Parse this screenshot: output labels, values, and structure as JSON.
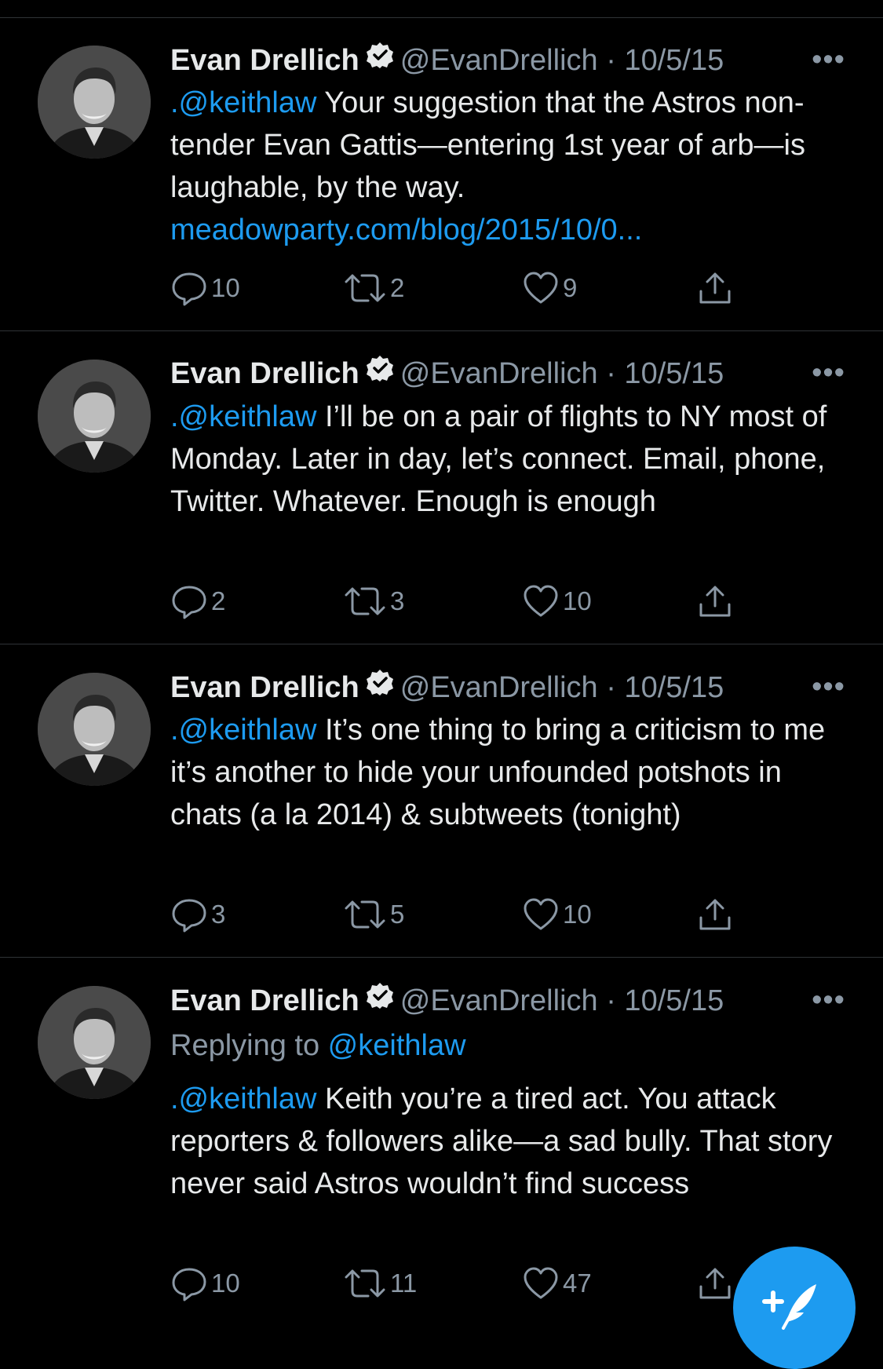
{
  "tweets": [
    {
      "author": "Evan Drellich",
      "handle": "@EvanDrellich",
      "date": "· 10/5/15",
      "more": "•••",
      "mention": ".@keithlaw",
      "text": " Your suggestion that the Astros non-tender Evan Gattis—entering 1st year of arb—is laughable, by the way.",
      "link": "meadowparty.com/blog/2015/10/0...",
      "replies": "10",
      "retweets": "2",
      "likes": "9"
    },
    {
      "author": "Evan Drellich",
      "handle": "@EvanDrellich",
      "date": "· 10/5/15",
      "more": "•••",
      "mention": ".@keithlaw",
      "text": " I’ll be on a pair of flights to NY most of Monday. Later in day, let’s connect. Email, phone, Twitter. Whatever. Enough is enough",
      "replies": "2",
      "retweets": "3",
      "likes": "10"
    },
    {
      "author": "Evan Drellich",
      "handle": "@EvanDrellich",
      "date": "· 10/5/15",
      "more": "•••",
      "mention": ".@keithlaw",
      "text": " It’s one thing to bring a criticism to me it’s another to hide your unfounded potshots in chats (a la 2014) & subtweets (tonight)",
      "replies": "3",
      "retweets": "5",
      "likes": "10"
    },
    {
      "author": "Evan Drellich",
      "handle": "@EvanDrellich",
      "date": "· 10/5/15",
      "more": "•••",
      "replying_label": "Replying to ",
      "replying_to": "@keithlaw",
      "mention": ".@keithlaw",
      "text": " Keith you’re a tired  act. You attack reporters & followers alike—a sad bully. That story never said Astros wouldn’t find success",
      "replies": "10",
      "retweets": "11",
      "likes": "47"
    }
  ],
  "icons": {
    "reply": "speech-bubble-icon",
    "retweet": "retweet-arrows-icon",
    "like": "heart-icon",
    "share": "share-upload-icon",
    "verified": "verified-badge-icon",
    "compose": "compose-feather-plus-icon"
  },
  "colors": {
    "background": "#000000",
    "text": "#e7e9ea",
    "muted": "#8b98a5",
    "accent": "#1d9bf0",
    "divider": "#2f3336"
  }
}
